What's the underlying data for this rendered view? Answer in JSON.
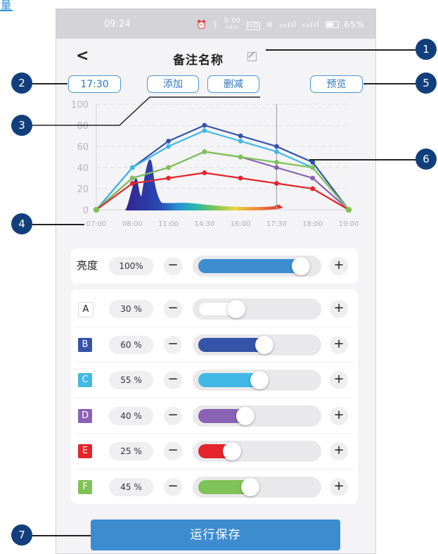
{
  "corner_glyph": "量",
  "status_bar": {
    "time": "09:24",
    "icons": [
      "alarm-icon",
      "bluetooth-icon",
      "network-speed-icon",
      "hd-icon",
      "wifi-icon",
      "signal-icon",
      "battery-icon"
    ],
    "speed": "5.00",
    "speed_unit": "KB/S",
    "hd": "HD",
    "signal_1": "5G",
    "signal_2": "5G",
    "battery": "65%"
  },
  "header": {
    "title": "备注名称"
  },
  "toolbar": {
    "time_label": "17:30",
    "add_label": "添加",
    "delete_label": "删减",
    "preview_label": "预览"
  },
  "chart_data": {
    "type": "line",
    "x": [
      "07:00",
      "08:00",
      "11:00",
      "14:30",
      "16:00",
      "17:30",
      "18:00",
      "19:00"
    ],
    "ylim": [
      0,
      100
    ],
    "yticks": [
      0,
      20,
      40,
      60,
      80,
      100
    ],
    "grid": true,
    "cursor_x": "17:30",
    "series": [
      {
        "key": "B",
        "color": "#3553a8",
        "values": [
          0,
          40,
          65,
          80,
          70,
          60,
          45,
          0
        ]
      },
      {
        "key": "C",
        "color": "#41b8e6",
        "values": [
          0,
          40,
          60,
          75,
          65,
          55,
          40,
          0
        ]
      },
      {
        "key": "D",
        "color": "#8a62b5",
        "values": [
          0,
          30,
          40,
          55,
          50,
          40,
          30,
          0
        ]
      },
      {
        "key": "F",
        "color": "#7fc257",
        "values": [
          0,
          30,
          40,
          55,
          50,
          45,
          40,
          0
        ]
      },
      {
        "key": "E",
        "color": "#e3252b",
        "values": [
          0,
          25,
          30,
          35,
          30,
          25,
          20,
          0
        ]
      }
    ]
  },
  "controls": {
    "main": {
      "label": "亮度",
      "percent": "100%",
      "value": 100,
      "fill": "#3d8cd0"
    },
    "channels": [
      {
        "label": "A",
        "percent": "30 %",
        "value": 30,
        "fill": "#ffffff",
        "badge_bg": "#ffffff",
        "badge_fg": "#222222"
      },
      {
        "label": "B",
        "percent": "60 %",
        "value": 60,
        "fill": "#3553a8",
        "badge_bg": "#3553a8",
        "badge_fg": "#ffffff"
      },
      {
        "label": "C",
        "percent": "55 %",
        "value": 55,
        "fill": "#41b8e6",
        "badge_bg": "#41b8e6",
        "badge_fg": "#ffffff"
      },
      {
        "label": "D",
        "percent": "40 %",
        "value": 40,
        "fill": "#8a62b5",
        "badge_bg": "#8a62b5",
        "badge_fg": "#ffffff"
      },
      {
        "label": "E",
        "percent": "25 %",
        "value": 25,
        "fill": "#e3252b",
        "badge_bg": "#e3252b",
        "badge_fg": "#ffffff"
      },
      {
        "label": "F",
        "percent": "45 %",
        "value": 45,
        "fill": "#7fc257",
        "badge_bg": "#7fc257",
        "badge_fg": "#ffffff"
      }
    ],
    "minus_symbol": "−",
    "plus_symbol": "+"
  },
  "save_label": "运行保存",
  "callouts": [
    "1",
    "2",
    "3",
    "4",
    "5",
    "6",
    "7"
  ]
}
